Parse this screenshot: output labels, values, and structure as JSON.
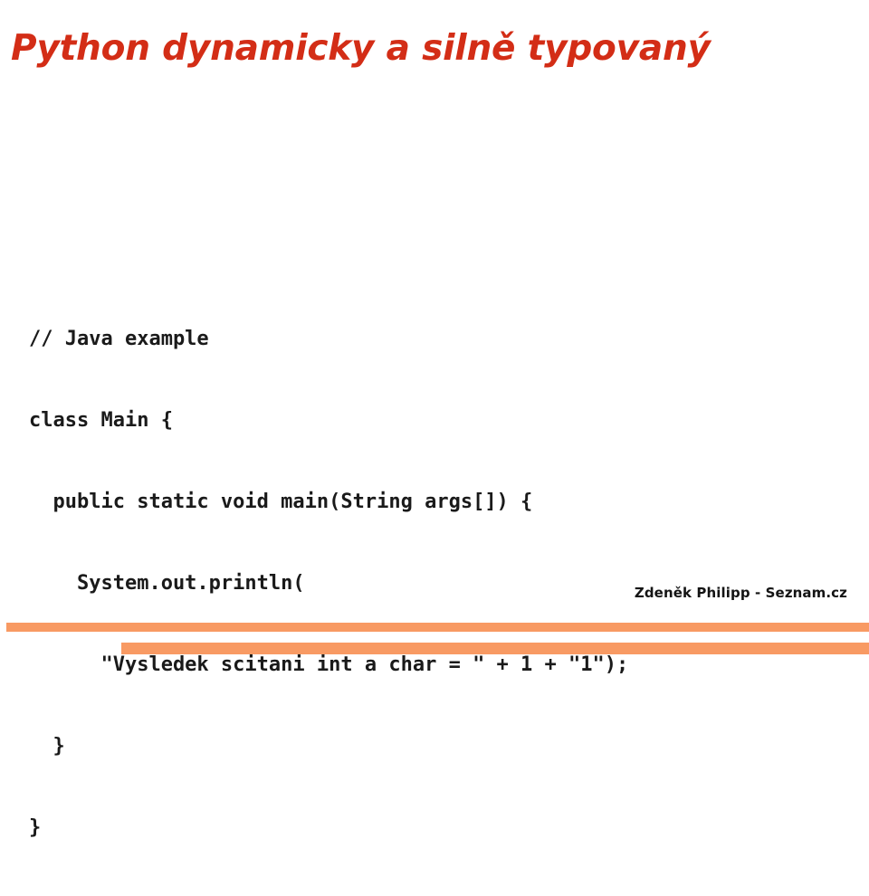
{
  "slide": {
    "title": "Python dynamicky a silně typovaný",
    "title_color": "#D32D16",
    "background_color": "#FFFFFF",
    "accent_bar_color": "#F89A63",
    "code_color": "#1A1A1A",
    "footer_color": "#141414"
  },
  "code": {
    "language": "java",
    "lines": [
      "// Java example",
      "class Main {",
      "  public static void main(String args[]) {",
      "    System.out.println(",
      "      \"Vysledek scitani int a char = \" + 1 + \"1\");",
      "  }",
      "}"
    ],
    "full_text": "// Java example\nclass Main {\n  public static void main(String args[]) {\n    System.out.println(\n      \"Vysledek scitani int a char = \" + 1 + \"1\");\n  }\n}"
  },
  "footer": {
    "credit": "Zdeněk Philipp - Seznam.cz"
  }
}
